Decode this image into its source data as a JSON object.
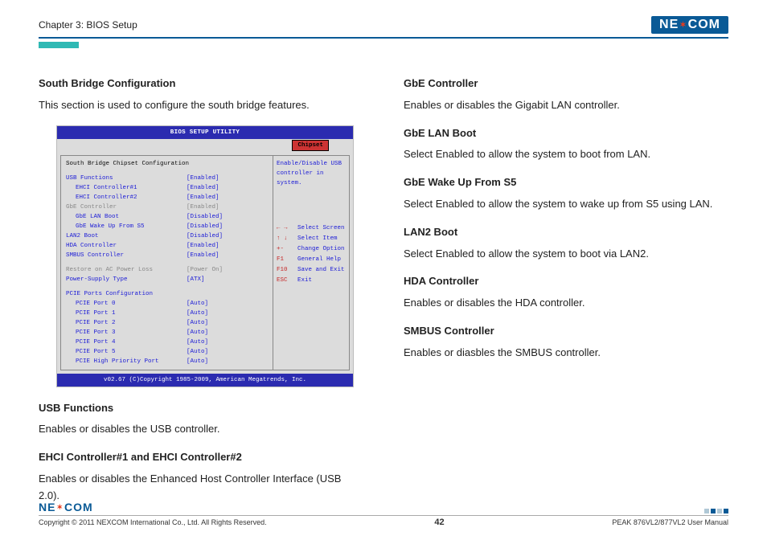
{
  "header": {
    "chapter": "Chapter 3: BIOS Setup",
    "brand_pre": "NE",
    "brand_post": "COM"
  },
  "left": {
    "h1": "South Bridge Configuration",
    "p1": "This section is used to configure the south bridge features.",
    "bios": {
      "title": "BIOS SETUP UTILITY",
      "tab": "Chipset",
      "section": "South Bridge Chipset Configuration",
      "rows": [
        {
          "label": "USB Functions",
          "value": "[Enabled]",
          "indent": 0,
          "cls": "blue"
        },
        {
          "label": "EHCI Controller#1",
          "value": "[Enabled]",
          "indent": 1,
          "cls": "blue"
        },
        {
          "label": "EHCI Controller#2",
          "value": "[Enabled]",
          "indent": 1,
          "cls": "blue"
        },
        {
          "label": "GbE Controller",
          "value": "[Enabled]",
          "indent": 0,
          "cls": "gray"
        },
        {
          "label": "GbE LAN Boot",
          "value": "[Disabled]",
          "indent": 1,
          "cls": "blue"
        },
        {
          "label": "GbE Wake Up From S5",
          "value": "[Disabled]",
          "indent": 1,
          "cls": "blue"
        },
        {
          "label": "LAN2 Boot",
          "value": "[Disabled]",
          "indent": 0,
          "cls": "blue"
        },
        {
          "label": "HDA Controller",
          "value": "[Enabled]",
          "indent": 0,
          "cls": "blue"
        },
        {
          "label": "SMBUS Controller",
          "value": "[Enabled]",
          "indent": 0,
          "cls": "blue"
        }
      ],
      "rows2": [
        {
          "label": "Restore on AC Power Loss",
          "value": "[Power On]",
          "indent": 0,
          "cls": "gray"
        },
        {
          "label": "Power-Supply Type",
          "value": "[ATX]",
          "indent": 0,
          "cls": "blue"
        }
      ],
      "rows3_header": "PCIE Ports Configuration",
      "rows3": [
        {
          "label": "PCIE Port 0",
          "value": "[Auto]",
          "indent": 1,
          "cls": "blue"
        },
        {
          "label": "PCIE Port 1",
          "value": "[Auto]",
          "indent": 1,
          "cls": "blue"
        },
        {
          "label": "PCIE Port 2",
          "value": "[Auto]",
          "indent": 1,
          "cls": "blue"
        },
        {
          "label": "PCIE Port 3",
          "value": "[Auto]",
          "indent": 1,
          "cls": "blue"
        },
        {
          "label": "PCIE Port 4",
          "value": "[Auto]",
          "indent": 1,
          "cls": "blue"
        },
        {
          "label": "PCIE Port 5",
          "value": "[Auto]",
          "indent": 1,
          "cls": "blue"
        },
        {
          "label": "PCIE High Priority Port",
          "value": "[Auto]",
          "indent": 1,
          "cls": "blue"
        }
      ],
      "help": "Enable/Disable USB controller in system.",
      "keys": [
        {
          "k": "← →",
          "d": "Select Screen"
        },
        {
          "k": "↑ ↓",
          "d": "Select Item"
        },
        {
          "k": "+-",
          "d": "Change Option"
        },
        {
          "k": "F1",
          "d": "General Help"
        },
        {
          "k": "F10",
          "d": "Save and Exit"
        },
        {
          "k": "ESC",
          "d": "Exit"
        }
      ],
      "footer": "v02.67 (C)Copyright 1985-2009, American Megatrends, Inc."
    },
    "h2": "USB Functions",
    "p2": "Enables or disables the USB controller.",
    "h3": "EHCI Controller#1 and EHCI Controller#2",
    "p3": "Enables or disables the Enhanced Host Controller Interface (USB 2.0)."
  },
  "right": {
    "h1": "GbE Controller",
    "p1": "Enables or disables the Gigabit LAN controller.",
    "h2": "GbE LAN Boot",
    "p2": "Select Enabled to allow the system to boot from LAN.",
    "h3": "GbE Wake Up From S5",
    "p3": "Select Enabled to allow the system to wake up from S5 using LAN.",
    "h4": "LAN2 Boot",
    "p4": "Select Enabled to allow the system to boot via LAN2.",
    "h5": "HDA Controller",
    "p5": "Enables or disables the HDA controller.",
    "h6": "SMBUS Controller",
    "p6": "Enables or diasbles the SMBUS controller."
  },
  "footer": {
    "copyright": "Copyright © 2011 NEXCOM International Co., Ltd. All Rights Reserved.",
    "page": "42",
    "manual": "PEAK 876VL2/877VL2 User Manual",
    "brand_pre": "NE",
    "brand_post": "COM"
  }
}
